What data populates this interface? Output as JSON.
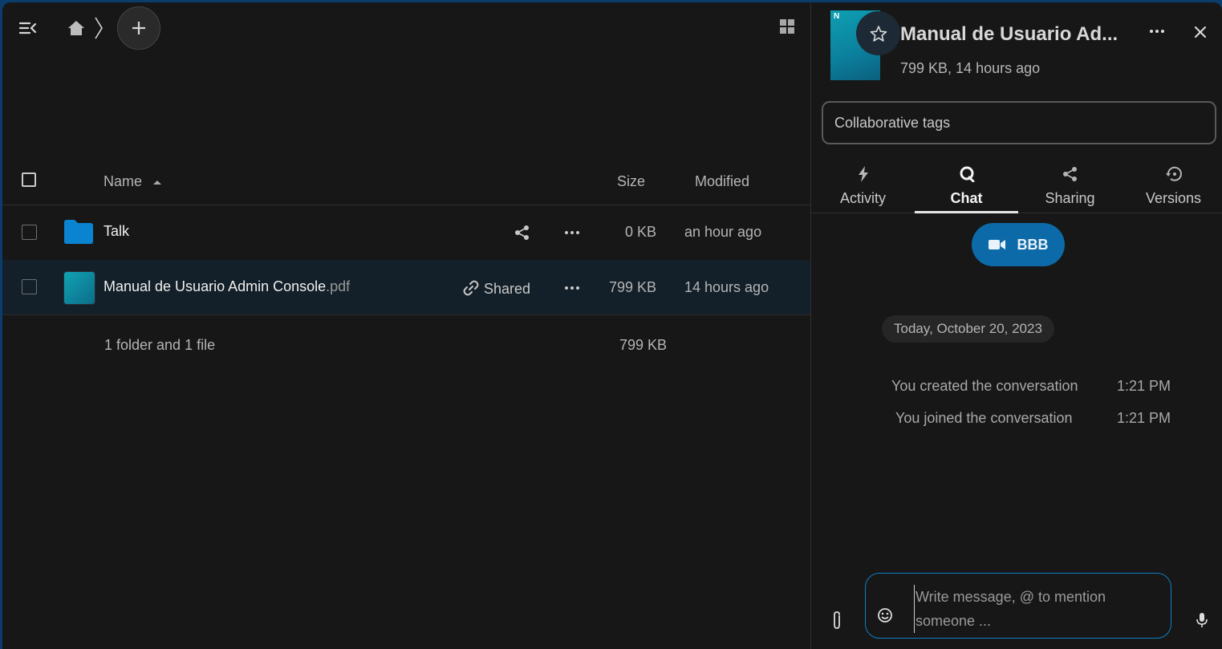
{
  "files": {
    "header": {
      "name": "Name",
      "size": "Size",
      "modified": "Modified"
    },
    "rows": [
      {
        "name": "Talk",
        "ext": "",
        "share": "",
        "size": "0 KB",
        "modified": "an hour ago"
      },
      {
        "name": "Manual de Usuario Admin Console",
        "ext": ".pdf",
        "share": "Shared",
        "size": "799 KB",
        "modified": "14 hours ago"
      }
    ],
    "summary": {
      "text": "1 folder and 1 file",
      "size": "799 KB"
    }
  },
  "sidebar": {
    "title": "Manual de Usuario Ad...",
    "subtitle": "799 KB, 14 hours ago",
    "tags_placeholder": "Collaborative tags",
    "tabs": [
      {
        "label": "Activity",
        "icon": "lightning-icon"
      },
      {
        "label": "Chat",
        "icon": "chat-bubble-icon"
      },
      {
        "label": "Sharing",
        "icon": "share-icon"
      },
      {
        "label": "Versions",
        "icon": "history-icon"
      }
    ],
    "active_tab": "Chat",
    "call_button": "BBB",
    "date": "Today, October 20, 2023",
    "messages": [
      {
        "text": "You created the conversation",
        "time": "1:21 PM"
      },
      {
        "text": "You joined the conversation",
        "time": "1:21 PM"
      }
    ],
    "composer_placeholder": "Write message, @ to mention someone ..."
  },
  "colors": {
    "accent": "#0d6aa8",
    "background": "#171717",
    "folder": "#0a84d0"
  }
}
